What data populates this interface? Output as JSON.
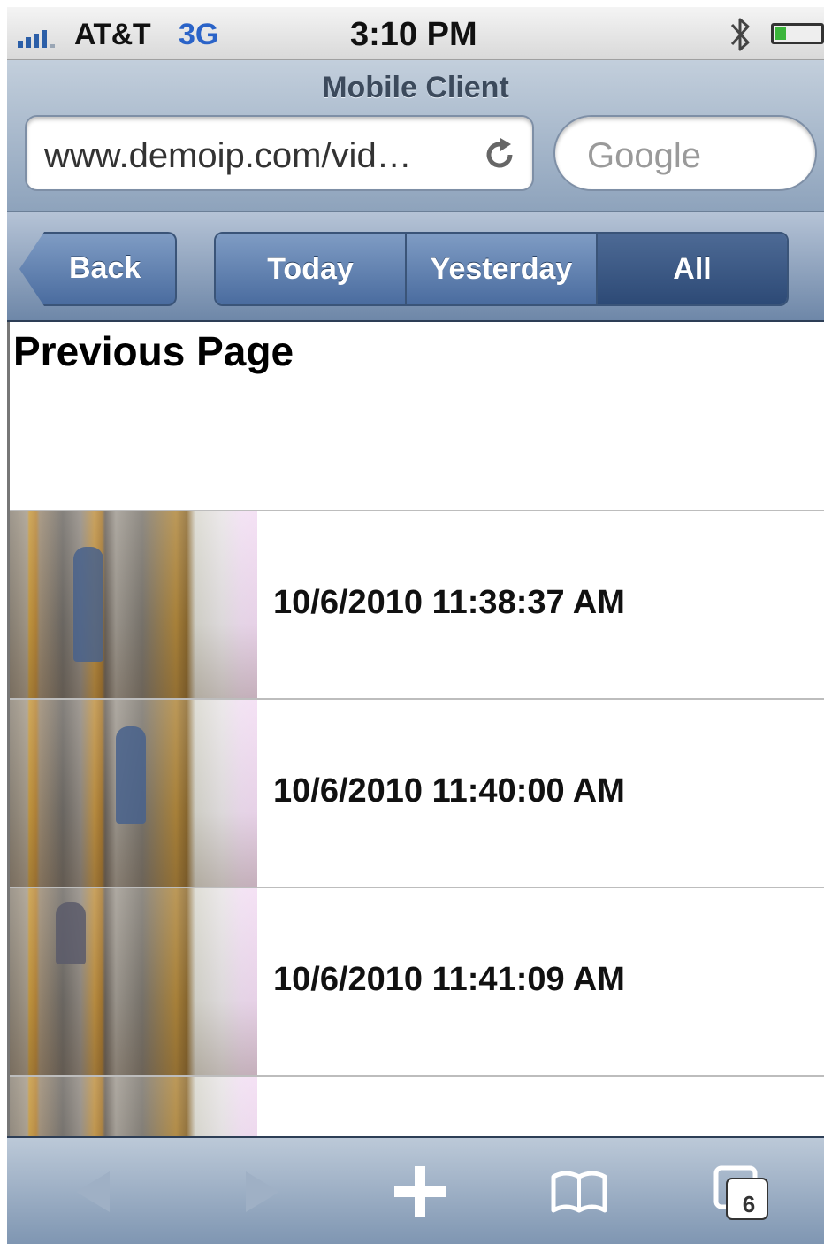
{
  "status_bar": {
    "carrier": "AT&T",
    "network": "3G",
    "time": "3:10 PM",
    "icons": [
      "signal-bars-icon",
      "bluetooth-icon",
      "battery-icon"
    ]
  },
  "browser": {
    "page_title": "Mobile Client",
    "url": "www.demoip.com/vid…",
    "search_placeholder": "Google",
    "tabs_count": "6"
  },
  "nav": {
    "back_label": "Back",
    "segments": [
      {
        "label": "Today",
        "selected": false
      },
      {
        "label": "Yesterday",
        "selected": false
      },
      {
        "label": "All",
        "selected": true
      }
    ]
  },
  "content": {
    "previous_page_label": "Previous Page",
    "items": [
      {
        "timestamp": "10/6/2010 11:38:37 AM"
      },
      {
        "timestamp": "10/6/2010 11:40:00 AM"
      },
      {
        "timestamp": "10/6/2010 11:41:09 AM"
      },
      {
        "timestamp": ""
      }
    ]
  },
  "colors": {
    "network_blue": "#2a63c8",
    "toolbar_blue": "#4a6c9f",
    "selected_segment": "#2d4a76"
  }
}
